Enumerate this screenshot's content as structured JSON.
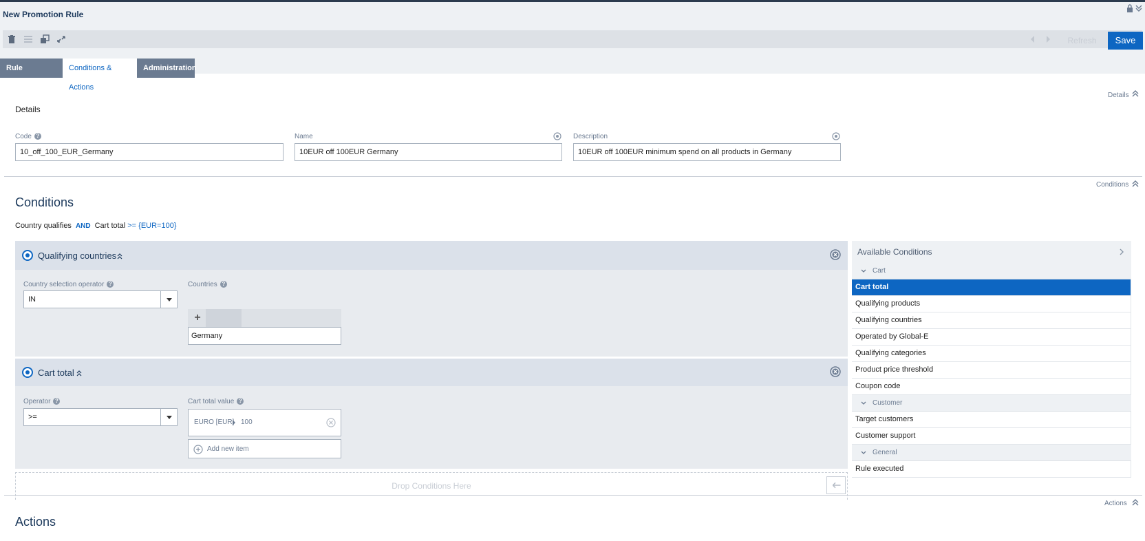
{
  "header": {
    "title": "New Promotion Rule",
    "refresh_label": "Refresh",
    "save_label": "Save"
  },
  "tabs": [
    {
      "label": "Rule Properties"
    },
    {
      "label": "Conditions & Actions",
      "active": true
    },
    {
      "label": "Administration"
    }
  ],
  "details": {
    "section_tag": "Details",
    "title": "Details",
    "code_label": "Code",
    "code_value": "10_off_100_EUR_Germany",
    "name_label": "Name",
    "name_value": "10EUR off 100EUR Germany",
    "description_label": "Description",
    "description_value": "10EUR off 100EUR minimum spend on all products in Germany"
  },
  "conditions": {
    "section_tag": "Conditions",
    "title": "Conditions",
    "summary": {
      "part1": "Country qualifies",
      "and": "AND",
      "part2": "Cart total",
      "value": ">= {EUR=100}"
    },
    "qualifying_countries": {
      "title": "Qualifying countries",
      "operator_label": "Country selection operator",
      "operator_value": "IN",
      "countries_label": "Countries",
      "countries": [
        "Germany"
      ]
    },
    "cart_total": {
      "title": "Cart total",
      "operator_label": "Operator",
      "operator_value": ">=",
      "value_label": "Cart total value",
      "currency": "EURO [EUR]",
      "amount": "100",
      "add_item_label": "Add new item"
    },
    "drop_label": "Drop Conditions Here"
  },
  "available_conditions": {
    "title": "Available Conditions",
    "groups": [
      {
        "label": "Cart",
        "items": [
          "Cart total",
          "Qualifying products",
          "Qualifying countries",
          "Operated by Global-E",
          "Qualifying categories",
          "Product price threshold",
          "Coupon code"
        ]
      },
      {
        "label": "Customer",
        "items": [
          "Target customers",
          "Customer support"
        ]
      },
      {
        "label": "General",
        "items": [
          "Rule executed"
        ]
      }
    ]
  },
  "actions": {
    "section_tag": "Actions",
    "title": "Actions"
  },
  "colors": {
    "accent": "#0d66c2",
    "tab_inactive": "#6b7b91",
    "header_bg": "#eef1f4"
  }
}
